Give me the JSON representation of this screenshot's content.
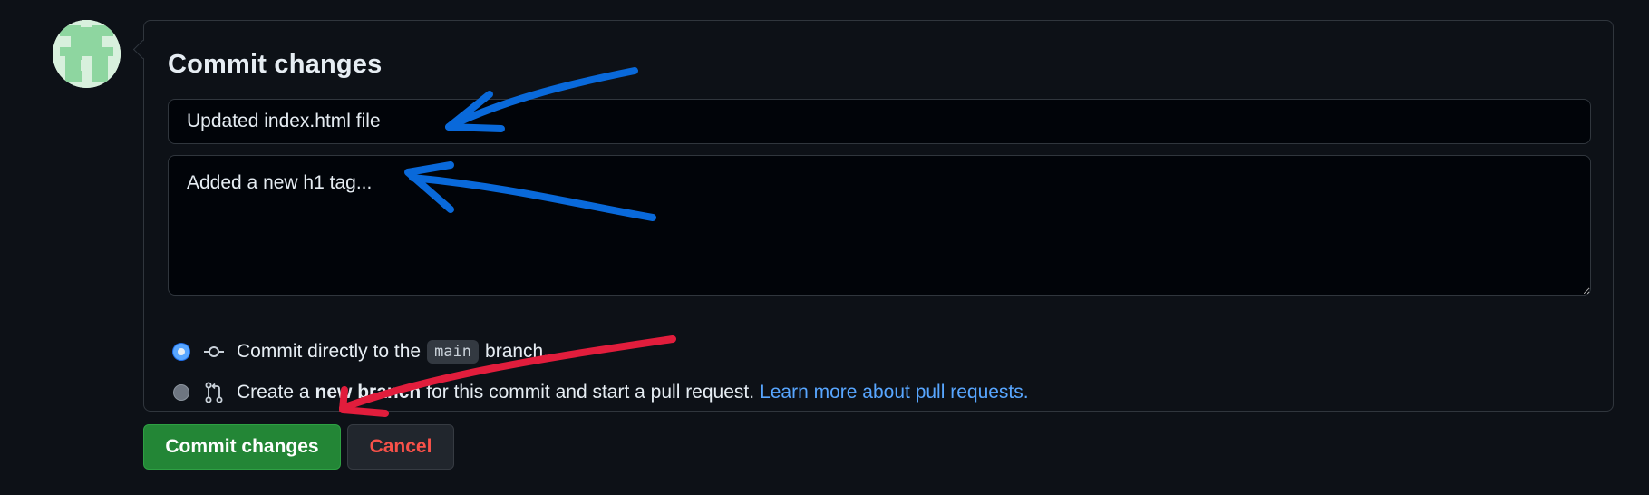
{
  "avatar": {
    "icon": "identicon-avatar"
  },
  "commit_panel": {
    "title": "Commit changes",
    "summary_value": "Updated index.html file",
    "description_value": "Added a new h1 tag...",
    "options": {
      "direct": {
        "prefix": "Commit directly to the",
        "branch": "main",
        "suffix": "branch.",
        "icon": "git-commit-icon",
        "checked": true
      },
      "new_branch": {
        "prefix": "Create a",
        "bold": "new branch",
        "suffix": "for this commit and start a pull request.",
        "link": "Learn more about pull requests.",
        "icon": "git-pull-request-icon",
        "checked": false
      }
    }
  },
  "actions": {
    "commit_label": "Commit changes",
    "cancel_label": "Cancel"
  },
  "colors": {
    "background": "#0d1117",
    "commit_button": "#238636",
    "cancel_text": "#f85149",
    "link": "#58a6ff",
    "annotation_blue": "#0969da",
    "annotation_red": "#e11d3c"
  }
}
